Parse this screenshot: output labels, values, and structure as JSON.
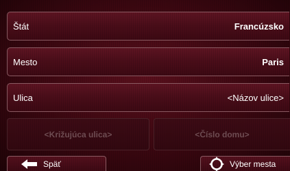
{
  "rows": {
    "state": {
      "label": "Štát",
      "value": "Francúzsko"
    },
    "city": {
      "label": "Mesto",
      "value": "Paris"
    },
    "street": {
      "label": "Ulica",
      "value": "<Názov ulice>"
    }
  },
  "actions": {
    "cross_street": "<Križujúca ulica>",
    "house_number": "<Číslo domu>"
  },
  "footer": {
    "back_label": "Späť",
    "select_city_label": "Výber mesta"
  },
  "icons": {
    "back": "arrow-left-icon",
    "select_city": "crosshair-icon"
  },
  "colors": {
    "background": "#3a0710",
    "disabled_text": "#6e4c52",
    "text": "#ffffff"
  }
}
